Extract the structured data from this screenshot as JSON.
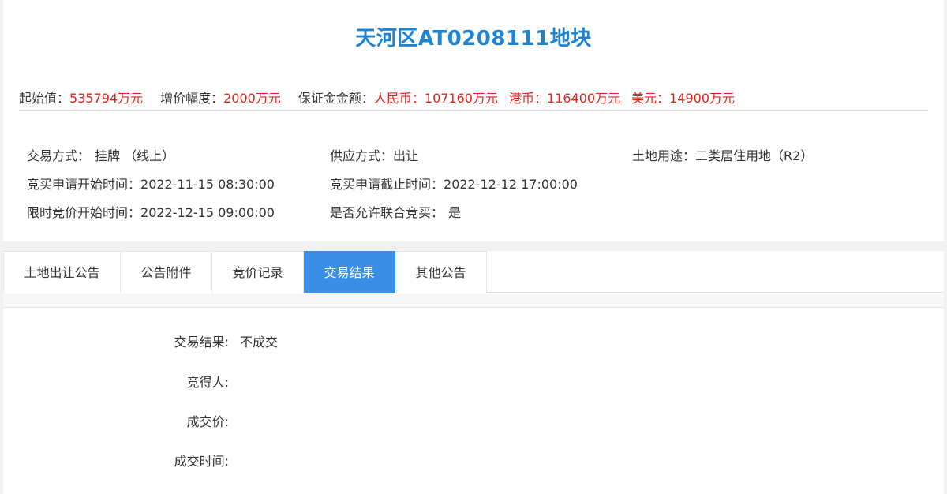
{
  "title": "天河区AT0208111地块",
  "prices": {
    "start_label": "起始值：",
    "start_value": "535794万元",
    "increment_label": "增价幅度：",
    "increment_value": "2000万元",
    "deposit_label": "保证金金额：",
    "rmb_label": "人民币：",
    "rmb_value": "107160万元",
    "hkd_label": "港币：",
    "hkd_value": "116400万元",
    "usd_label": "美元：",
    "usd_value": "14900万元"
  },
  "info": {
    "trade_method_label": "交易方式：",
    "trade_method_value": "挂牌 （线上）",
    "supply_label": "供应方式：",
    "supply_value": "出让",
    "land_use_label": "土地用途：",
    "land_use_value": "二类居住用地（R2）",
    "apply_start_label": "竞买申请开始时间：",
    "apply_start_value": "2022-11-15 08:30:00",
    "apply_end_label": "竞买申请截止时间：",
    "apply_end_value": "2022-12-12 17:00:00",
    "bid_start_label": "限时竞价开始时间：",
    "bid_start_value": "2022-12-15 09:00:00",
    "joint_label": "是否允许联合竞买：",
    "joint_value": "是"
  },
  "tabs": [
    {
      "label": "土地出让公告"
    },
    {
      "label": "公告附件"
    },
    {
      "label": "竞价记录"
    },
    {
      "label": "交易结果"
    },
    {
      "label": "其他公告"
    }
  ],
  "active_tab": "交易结果",
  "result": {
    "status_label": "交易结果:",
    "status_value": "不成交",
    "winner_label": "竞得人:",
    "winner_value": "",
    "price_label": "成交价:",
    "price_value": "",
    "time_label": "成交时间:",
    "time_value": ""
  },
  "colors": {
    "title": "#1e83d0",
    "price_red": "#e0251c",
    "active_tab": "#3a8ee6"
  }
}
